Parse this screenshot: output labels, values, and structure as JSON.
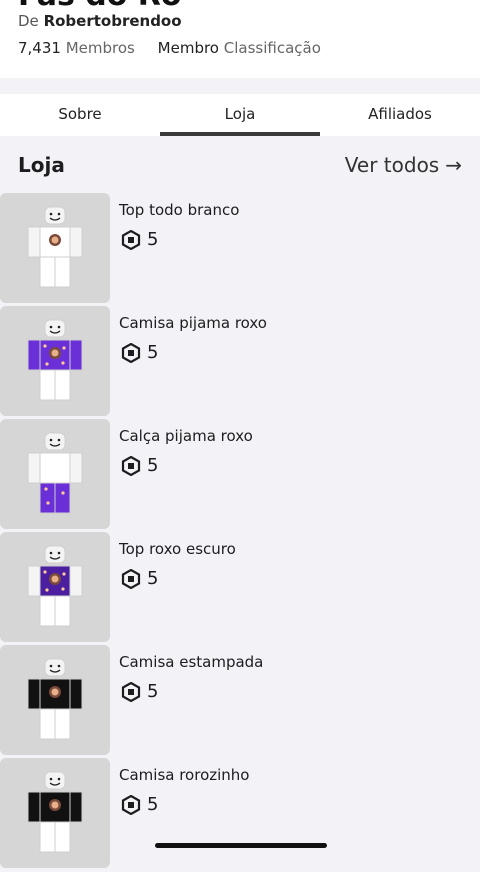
{
  "group": {
    "title": "Fãs do Ro",
    "by_prefix": "De",
    "owner": "Robertobrendoo",
    "members_count": "7,431",
    "members_label": "Membros",
    "rank_label": "Membro",
    "rank_caption": "Classificação"
  },
  "tabs": [
    {
      "label": "Sobre",
      "active": false
    },
    {
      "label": "Loja",
      "active": true
    },
    {
      "label": "Afiliados",
      "active": false
    }
  ],
  "store": {
    "title": "Loja",
    "see_all": "Ver todos",
    "arrow": "→",
    "items": [
      {
        "name": "Top todo branco",
        "price": "5",
        "shirt_color": "#ffffff",
        "pants_color": "#ffffff",
        "print": true,
        "sleeves": false
      },
      {
        "name": "Camisa pijama roxo",
        "price": "5",
        "shirt_color": "#6a2fd6",
        "pants_color": "#ffffff",
        "print": true,
        "sleeves": true
      },
      {
        "name": "Calça pijama roxo",
        "price": "5",
        "shirt_color": "#ffffff",
        "pants_color": "#6a2fd6",
        "print": false,
        "sleeves": false
      },
      {
        "name": "Top roxo escuro",
        "price": "5",
        "shirt_color": "#4b1fa0",
        "pants_color": "#ffffff",
        "print": true,
        "sleeves": false
      },
      {
        "name": "Camisa estampada",
        "price": "5",
        "shirt_color": "#111111",
        "pants_color": "#ffffff",
        "print": true,
        "sleeves": true
      },
      {
        "name": "Camisa rorozinho",
        "price": "5",
        "shirt_color": "#111111",
        "pants_color": "#ffffff",
        "print": true,
        "sleeves": true
      }
    ]
  },
  "icons": {
    "currency": "robux-icon",
    "see_all_arrow": "arrow-right-icon"
  }
}
